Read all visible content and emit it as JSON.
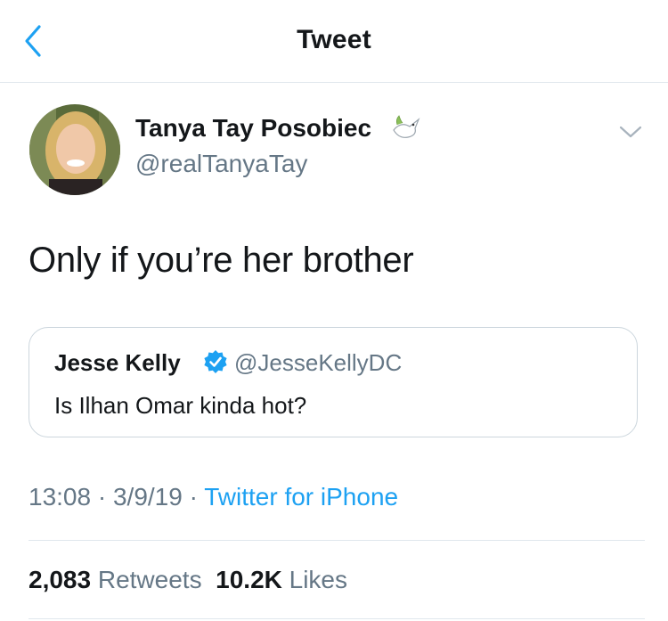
{
  "header": {
    "title": "Tweet"
  },
  "icons": {
    "back": "chevron-left-icon",
    "caret": "chevron-down-icon",
    "dove": "dove-emoji-icon",
    "verified": "verified-badge-icon"
  },
  "colors": {
    "accent": "#1da1f2",
    "text": "#14171a",
    "secondary": "#657786",
    "border": "#ccd6dd"
  },
  "author": {
    "name": "Tanya Tay Posobiec",
    "handle": "@realTanyaTay"
  },
  "tweet": {
    "text": "Only if you’re her brother"
  },
  "quoted": {
    "name": "Jesse Kelly",
    "handle": "@JesseKellyDC",
    "text": "Is Ilhan Omar kinda hot?"
  },
  "meta": {
    "time": "13:08",
    "sep1": " · ",
    "date": "3/9/19",
    "sep2": " · ",
    "source": "Twitter for iPhone"
  },
  "stats": {
    "retweets_count": "2,083",
    "retweets_label": "Retweets",
    "likes_count": "10.2K",
    "likes_label": "Likes"
  }
}
